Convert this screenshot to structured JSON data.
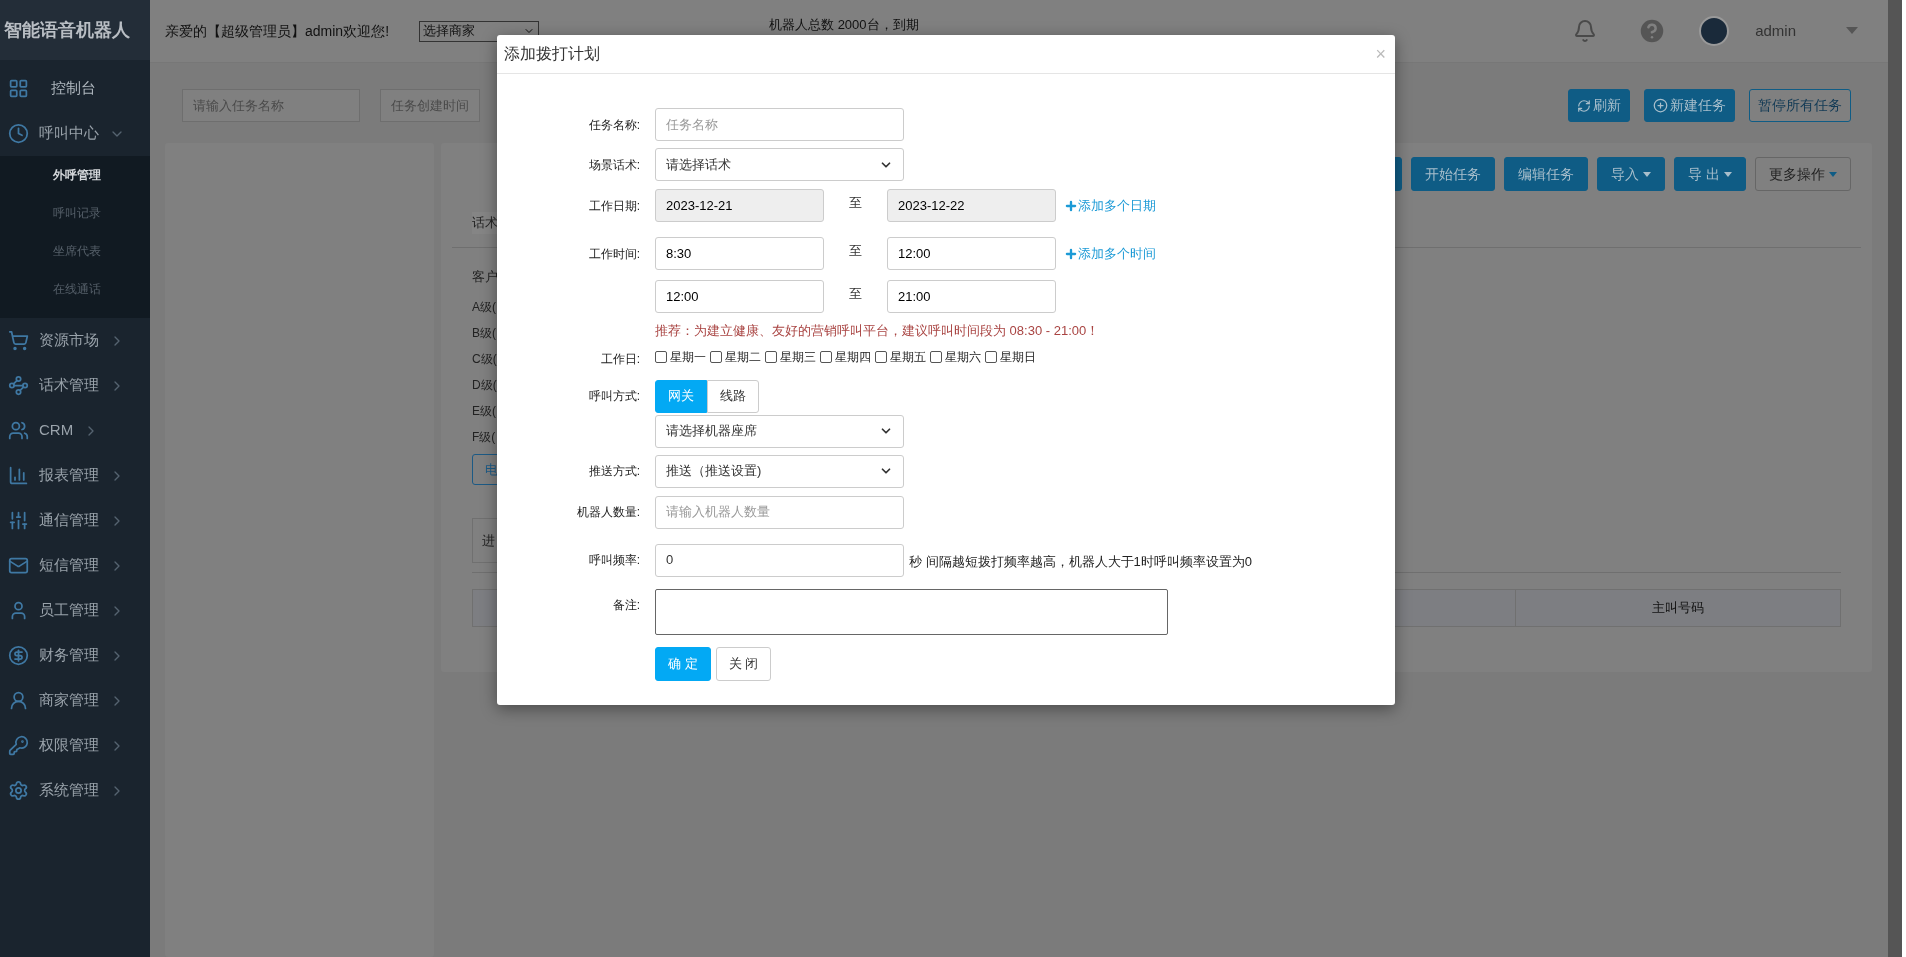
{
  "sidebar": {
    "title": "智能语音机器人",
    "items": [
      {
        "label": "控制台"
      },
      {
        "label": "呼叫中心",
        "expanded": true,
        "children": [
          {
            "label": "外呼管理",
            "selected": true
          },
          {
            "label": "呼叫记录",
            "selected": false
          },
          {
            "label": "坐席代表",
            "selected": false
          },
          {
            "label": "在线通话",
            "selected": false
          }
        ]
      },
      {
        "label": "资源市场",
        "expanded": false
      },
      {
        "label": "话术管理",
        "expanded": false
      },
      {
        "label": "CRM",
        "expanded": false
      },
      {
        "label": "报表管理",
        "expanded": false
      },
      {
        "label": "通信管理",
        "expanded": false
      },
      {
        "label": "短信管理",
        "expanded": false
      },
      {
        "label": "员工管理",
        "expanded": false
      },
      {
        "label": "财务管理",
        "expanded": false
      },
      {
        "label": "商家管理",
        "expanded": false
      },
      {
        "label": "权限管理",
        "expanded": false
      },
      {
        "label": "系统管理",
        "expanded": false
      }
    ]
  },
  "topbar": {
    "greeting": "亲爱的【超级管理员】admin欢迎您!",
    "merchant_select": "选择商家",
    "robot_info": "机器人总数 2000台，到期",
    "user": "admin"
  },
  "toolbar": {
    "search_placeholder": "请输入任务名称",
    "date_placeholder": "任务创建时间",
    "buttons": [
      {
        "label": "刷新",
        "kind": "primary"
      },
      {
        "label": "新建任务",
        "kind": "primary"
      },
      {
        "label": "暂停所有任务",
        "kind": "outline"
      }
    ]
  },
  "panel": {
    "buttons": [
      {
        "kind": "primary",
        "dropdown": false
      },
      {
        "label": "开始任务",
        "kind": "primary",
        "dropdown": false
      },
      {
        "label": "编辑任务",
        "kind": "primary",
        "dropdown": false
      },
      {
        "label": "导入",
        "kind": "primary",
        "dropdown": true
      },
      {
        "label": "导 出",
        "kind": "primary",
        "dropdown": true
      },
      {
        "label": "更多操作",
        "kind": "default",
        "dropdown": true
      }
    ],
    "tag": "话术",
    "group_label": "客户",
    "levels": [
      "A级(",
      "B级(",
      "C级(",
      "D级(",
      "E级(",
      "F级("
    ],
    "button": "电",
    "tab": "进",
    "table_columns": [
      "主叫号码"
    ]
  },
  "modal": {
    "title": "添加拨打计划",
    "close": "×",
    "task_name": {
      "label": "任务名称:",
      "placeholder": "任务名称"
    },
    "script": {
      "label": "场景话术:",
      "value": "请选择话术"
    },
    "work_date": {
      "label": "工作日期:",
      "disabled": true,
      "from": "2023-12-21",
      "separator": "至",
      "to": "2023-12-22",
      "add_link": "添加多个日期"
    },
    "work_time": {
      "label": "工作时间:",
      "add_link": "添加多个时间",
      "ranges": [
        {
          "from": "8:30",
          "separator": "至",
          "to": "12:00"
        },
        {
          "from": "12:00",
          "separator": "至",
          "to": "21:00"
        }
      ]
    },
    "hint": "推荐：为建立健康、友好的营销呼叫平台，建议呼叫时间段为 08:30 - 21:00！",
    "weekdays": {
      "label": "工作日:",
      "days": [
        {
          "label": "星期一",
          "checked": false
        },
        {
          "label": "星期二",
          "checked": false
        },
        {
          "label": "星期三",
          "checked": false
        },
        {
          "label": "星期四",
          "checked": false
        },
        {
          "label": "星期五",
          "checked": false
        },
        {
          "label": "星期六",
          "checked": false
        },
        {
          "label": "星期日",
          "checked": false
        }
      ]
    },
    "call_mode": {
      "label": "呼叫方式:",
      "options": [
        {
          "label": "网关",
          "selected": true
        },
        {
          "label": "线路",
          "selected": false
        }
      ],
      "seat_select": "请选择机器座席"
    },
    "push": {
      "label": "推送方式:",
      "value": "推送（推送设置)"
    },
    "robots": {
      "label": "机器人数量:",
      "placeholder": "请输入机器人数量"
    },
    "frequency": {
      "label": "呼叫频率:",
      "value": "0",
      "note": "秒 间隔越短拨打频率越高，机器人大于1时呼叫频率设置为0"
    },
    "remark": {
      "label": "备注:"
    },
    "buttons": [
      {
        "label": "确 定",
        "kind": "primary"
      },
      {
        "label": "关 闭",
        "kind": "default"
      }
    ]
  }
}
